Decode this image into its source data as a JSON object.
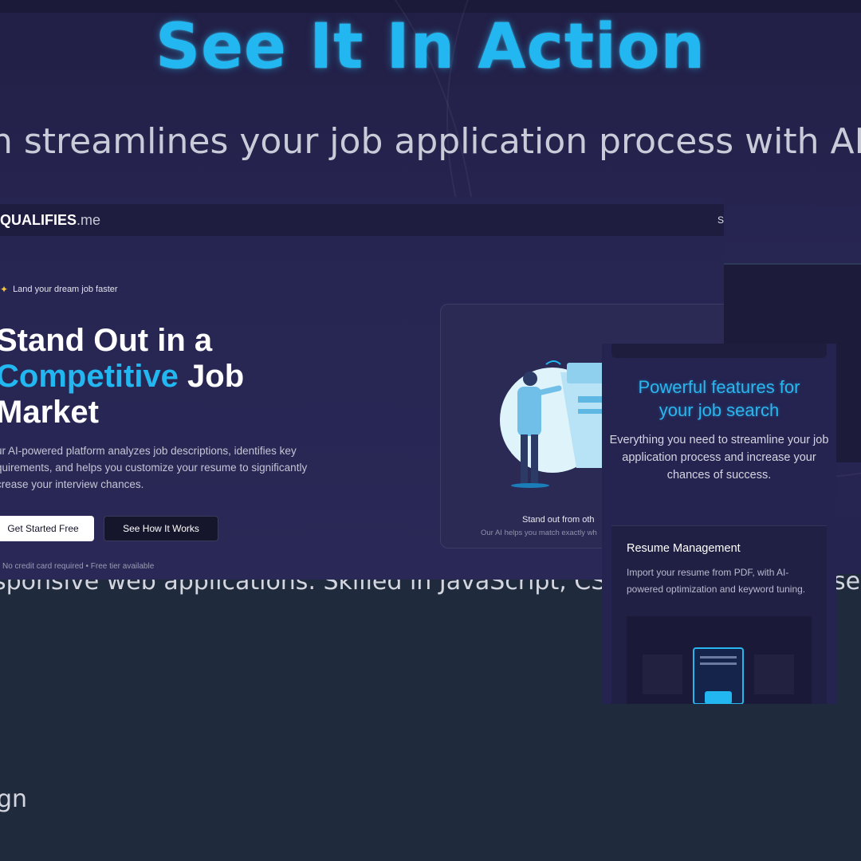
{
  "page": {
    "title": "See It In Action",
    "subtitle_fragment": "n streamlines your job application process with AI-p",
    "behind_text": "sponsive web applications. Skilled in JavaScript, CS",
    "behind_text_right": "sed",
    "behind_small": "gn"
  },
  "site": {
    "logo_main": "QUALIFIES",
    "logo_tld": ".me",
    "nav_fragment": "S"
  },
  "hero": {
    "tag_icon": "sparkle-icon",
    "tag_label": "Land your dream job faster",
    "headline_line1": "Stand Out in a",
    "headline_highlight": "Competitive",
    "headline_job": " Job",
    "headline_line3": "Market",
    "paragraph": "ur AI-powered platform analyzes job descriptions, identifies key quirements, and helps you customize your resume to significantly crease your interview chances.",
    "primary_button": "Get Started Free",
    "secondary_button": "See How It Works",
    "note": "No credit card required • Free tier available",
    "illustration_caption": "Stand out from oth",
    "illustration_subcaption": "Our AI helps you match exactly wh"
  },
  "mobile": {
    "heading_line1": "Powerful features for",
    "heading_line2": "your job search",
    "description": "Everything you need to streamline your job application process and increase your chances of success.",
    "card_title": "Resume Management",
    "card_text": "Import your resume from PDF, with AI-powered optimization and keyword tuning."
  },
  "colors": {
    "accent": "#22b7f0",
    "background": "#252350",
    "lower_background": "#1f2a3d"
  }
}
